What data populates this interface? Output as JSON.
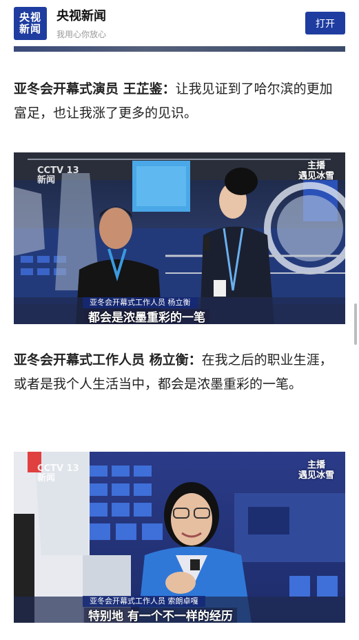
{
  "header": {
    "logo_line1": "央视",
    "logo_line2": "新闻",
    "title": "央视新闻",
    "slogan": "我用心你放心",
    "open_button": "打开"
  },
  "paragraphs": [
    {
      "speaker": "亚冬会开幕式演员 王芷鉴：",
      "text": "让我见证到了哈尔滨的更加富足，也让我涨了更多的见识。"
    },
    {
      "speaker": "亚冬会开幕式工作人员 杨立衡：",
      "text": "在我之后的职业生涯，或者是我个人生活当中，都会是浓墨重彩的一笔。"
    }
  ],
  "photos": [
    {
      "channel": "CCTV 13",
      "channel_sub": "新闻",
      "watermark_line1": "主播",
      "watermark_line2": "遇见冰雪",
      "name_caption": "亚冬会开幕式工作人员 杨立衡",
      "subtitle": "都会是浓墨重彩的一笔"
    },
    {
      "channel": "CCTV 13",
      "channel_sub": "新闻",
      "watermark_line1": "主播",
      "watermark_line2": "遇见冰雪",
      "name_caption": "亚冬会开幕式工作人员 索朗卓嘎",
      "subtitle": "特别地 有一个不一样的经历"
    }
  ],
  "colors": {
    "brand_blue": "#1f3da0",
    "text": "#222222"
  }
}
